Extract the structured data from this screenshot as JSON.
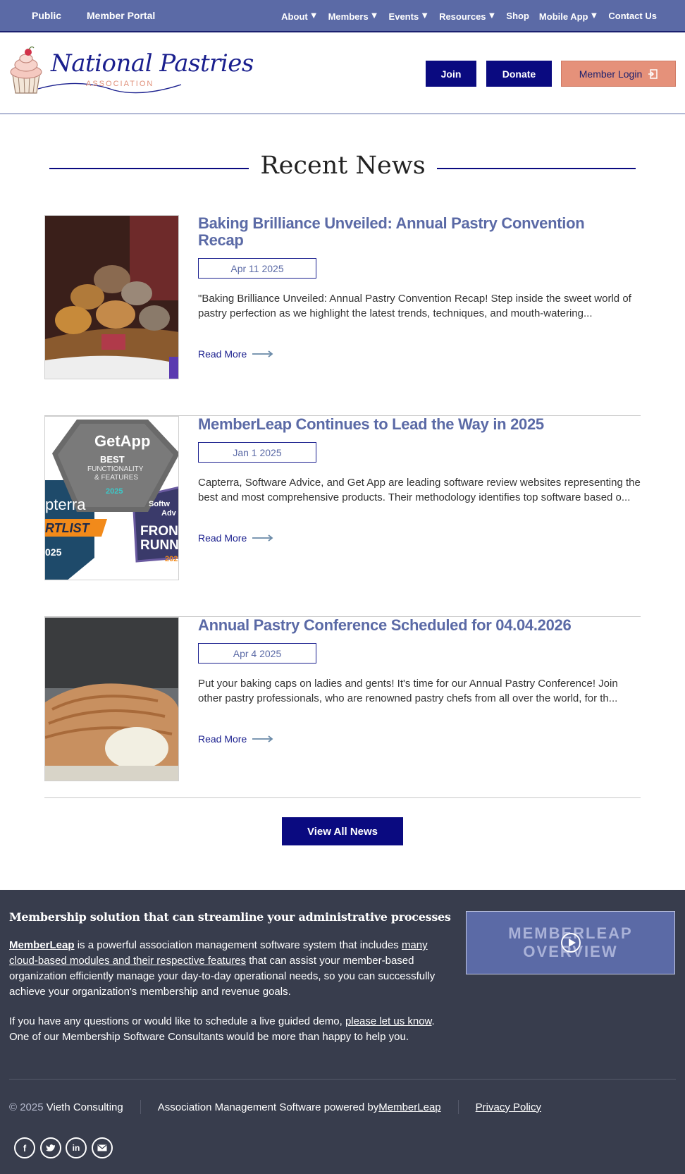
{
  "topbar": {
    "left": [
      "Public",
      "Member Portal"
    ],
    "nav": [
      {
        "label": "About",
        "dropdown": true
      },
      {
        "label": "Members",
        "dropdown": true
      },
      {
        "label": "Events",
        "dropdown": true
      },
      {
        "label": "Resources",
        "dropdown": true
      },
      {
        "label": "Shop",
        "dropdown": false
      },
      {
        "label": "Mobile App",
        "dropdown": true
      },
      {
        "label": "Contact Us",
        "dropdown": false
      }
    ]
  },
  "header": {
    "logo_title": "National Pastries",
    "logo_sub": "ASSOCIATION",
    "join_label": "Join",
    "donate_label": "Donate",
    "login_label": "Member Login"
  },
  "news": {
    "heading": "Recent News",
    "read_more": "Read More",
    "articles": [
      {
        "title": "Baking Brilliance Unveiled: Annual Pastry Convention Recap",
        "date": "Apr 11 2025",
        "summary": "\"Baking Brilliance Unveiled: Annual Pastry Convention Recap! Step inside the sweet world of pastry perfection as we highlight the latest trends, techniques, and mouth-watering..."
      },
      {
        "title": "MemberLeap Continues to Lead the Way in 2025",
        "date": "Jan 1 2025",
        "summary": "Capterra, Software Advice, and Get App are leading software review websites representing the best and most comprehensive products. Their methodology identifies top software based o..."
      },
      {
        "title": "Annual Pastry Conference Scheduled for 04.04.2026",
        "date": "Apr 4 2025",
        "summary": "Put your baking caps on ladies and gents! It's time for our Annual Pastry Conference! Join other pastry professionals, who are renowned pastry chefs from all over the world, for th..."
      }
    ],
    "badge": {
      "getapp": "GetApp",
      "best": "BEST",
      "functionality": "FUNCTIONALITY",
      "features": "& FEATURES",
      "year": "2025",
      "capterra": "pterra",
      "shortlist": "RTLIST",
      "cap_year": "025",
      "sw_top": "Softw",
      "sw_adv": "Adv",
      "front": "FRON",
      "runner": "RUNN",
      "sw_year": "202"
    },
    "view_all": "View All News"
  },
  "footer": {
    "title": "Membership solution that can streamline your administrative processes",
    "p1_link1": "MemberLeap",
    "p1_text1": " is a powerful association management software system that includes ",
    "p1_link2": "many cloud-based modules and their respective features",
    "p1_text2": " that can assist your member-based organization efficiently manage your day-to-day operational needs, so you can successfully achieve your organization's membership and revenue goals.",
    "p2_text1": "If you have any questions or would like to schedule a live guided demo, ",
    "p2_link": "please let us know",
    "p2_text2": ". One of our Membership Software Consultants would be more than happy to help you.",
    "video_line1": "MEMBERLEAP",
    "video_line2": "OVERVIEW",
    "copyright_year": "© 2025",
    "copyright_org": "Vieth Consulting",
    "powered_text": "Association Management Software powered by ",
    "powered_link": "MemberLeap",
    "privacy": "Privacy Policy",
    "social": [
      "facebook-icon",
      "twitter-icon",
      "linkedin-icon",
      "email-icon"
    ]
  },
  "colors": {
    "brand_navy": "#0a0a80",
    "topbar": "#5b6aa6",
    "accent_salmon": "#e5917a",
    "footer_bg": "#383d4d",
    "title_blue": "#5b6aa6"
  }
}
